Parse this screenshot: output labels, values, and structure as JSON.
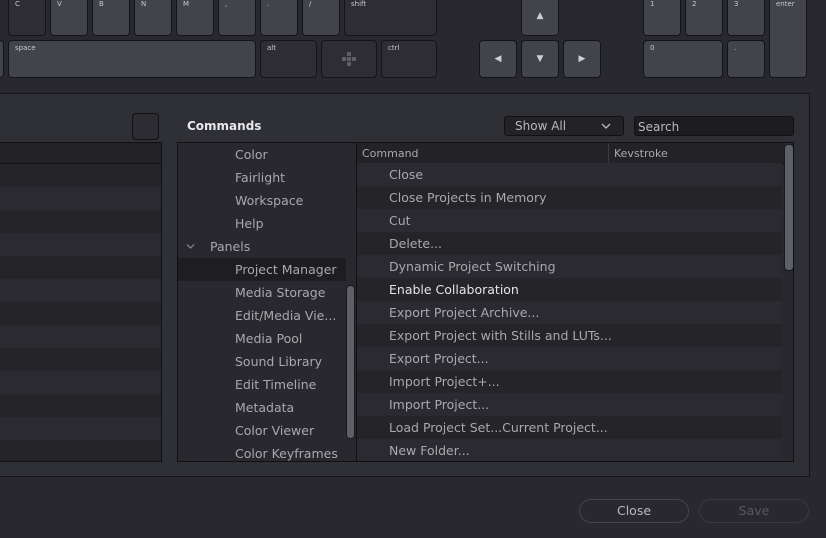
{
  "keyboard": {
    "row1": [
      {
        "label": "C",
        "style": "dark"
      },
      {
        "label": "V"
      },
      {
        "label": "B"
      },
      {
        "label": "N"
      },
      {
        "label": "M"
      },
      {
        "label": ","
      },
      {
        "label": "."
      },
      {
        "label": "/"
      },
      {
        "label": "shift",
        "style": "dark"
      }
    ],
    "row2": [
      {
        "label": "space"
      },
      {
        "label": "alt",
        "style": "dark"
      },
      {
        "label": "",
        "icon": "move-icon",
        "style": "dark"
      },
      {
        "label": "ctrl",
        "style": "dark"
      }
    ],
    "arrows": {
      "up": "▲",
      "left": "◀",
      "down": "▼",
      "right": "▶"
    },
    "numpad": {
      "k1": "1",
      "k2": "2",
      "k3": "3",
      "enter": "enter",
      "k0": "0",
      "dot": "."
    }
  },
  "commands": {
    "title": "Commands",
    "filter_selected": "Show All",
    "search_placeholder": "Search",
    "tree": [
      {
        "label": "Color",
        "type": "child"
      },
      {
        "label": "Fairlight",
        "type": "child"
      },
      {
        "label": "Workspace",
        "type": "child"
      },
      {
        "label": "Help",
        "type": "child"
      },
      {
        "label": "Panels",
        "type": "group",
        "expanded": true
      },
      {
        "label": "Project Manager",
        "type": "child",
        "selected": true
      },
      {
        "label": "Media Storage",
        "type": "child"
      },
      {
        "label": "Edit/Media Vie...",
        "type": "child"
      },
      {
        "label": "Media Pool",
        "type": "child"
      },
      {
        "label": "Sound Library",
        "type": "child"
      },
      {
        "label": "Edit Timeline",
        "type": "child"
      },
      {
        "label": "Metadata",
        "type": "child"
      },
      {
        "label": "Color Viewer",
        "type": "child"
      },
      {
        "label": "Color Keyframes",
        "type": "child"
      }
    ],
    "columns": {
      "command": "Command",
      "keystroke": "Kevstroke"
    },
    "rows": [
      {
        "command": "Close",
        "keystroke": ""
      },
      {
        "command": "Close Projects in Memory",
        "keystroke": ""
      },
      {
        "command": "Cut",
        "keystroke": ""
      },
      {
        "command": "Delete...",
        "keystroke": ""
      },
      {
        "command": "Dynamic Project Switching",
        "keystroke": ""
      },
      {
        "command": "Enable Collaboration",
        "keystroke": "",
        "highlighted": true
      },
      {
        "command": "Export Project Archive...",
        "keystroke": ""
      },
      {
        "command": "Export Project with Stills and LUTs...",
        "keystroke": ""
      },
      {
        "command": "Export Project...",
        "keystroke": ""
      },
      {
        "command": "Import Project+...",
        "keystroke": ""
      },
      {
        "command": "Import Project...",
        "keystroke": ""
      },
      {
        "command": "Load Project Set...Current Project...",
        "keystroke": ""
      },
      {
        "command": "New Folder...",
        "keystroke": ""
      }
    ]
  },
  "footer": {
    "close_label": "Close",
    "save_label": "Save",
    "save_enabled": false
  }
}
